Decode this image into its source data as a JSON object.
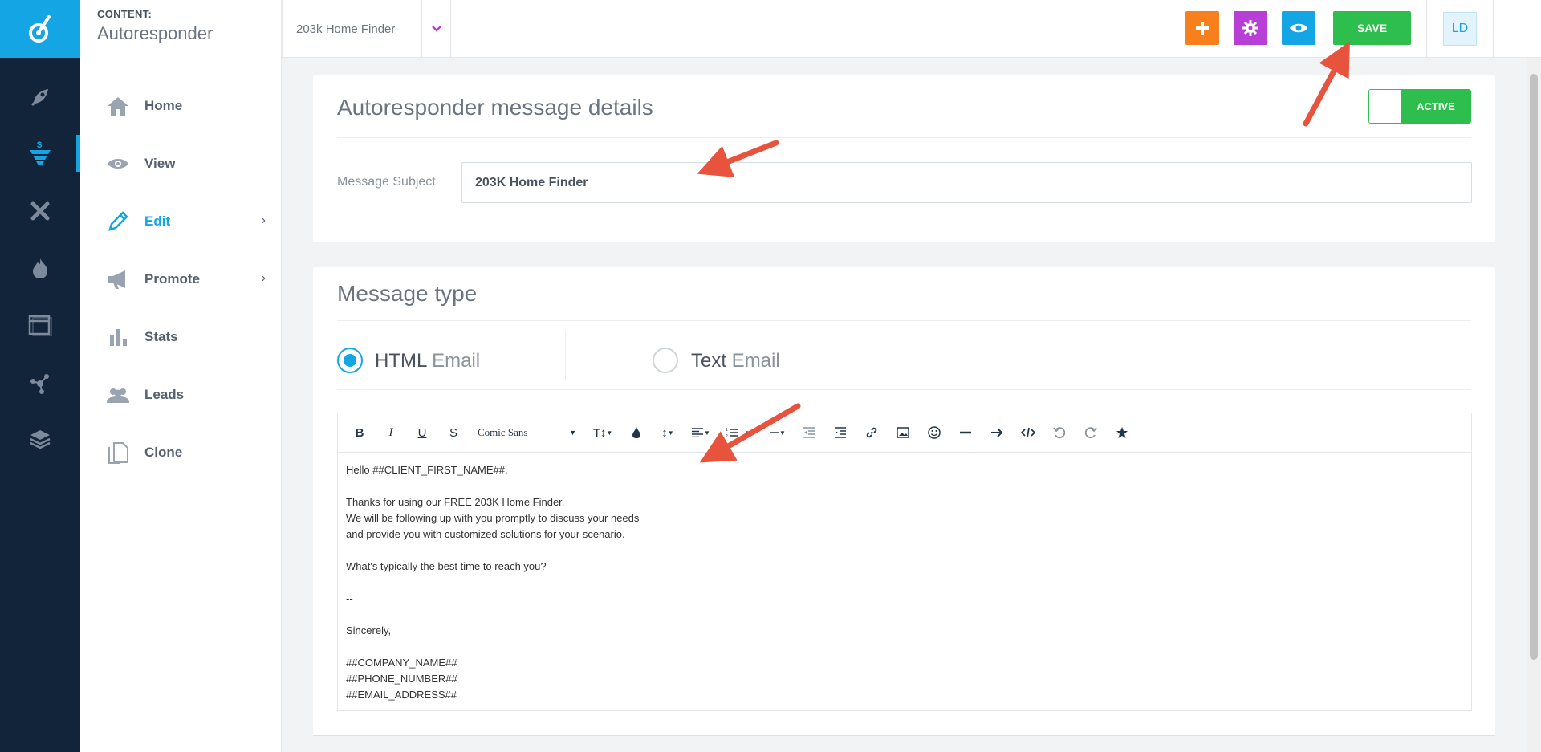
{
  "header": {
    "section_label": "CONTENT:",
    "section_title": "Autoresponder",
    "crumb": "203k Home Finder",
    "save_label": "SAVE",
    "avatar_initials": "LD"
  },
  "sidebar": {
    "items": [
      {
        "label": "Home",
        "icon": "home-icon"
      },
      {
        "label": "View",
        "icon": "eye-icon"
      },
      {
        "label": "Edit",
        "icon": "pencil-icon",
        "active": true
      },
      {
        "label": "Promote",
        "icon": "megaphone-icon"
      },
      {
        "label": "Stats",
        "icon": "bar-chart-icon"
      },
      {
        "label": "Leads",
        "icon": "people-icon"
      },
      {
        "label": "Clone",
        "icon": "copy-icon"
      }
    ]
  },
  "details": {
    "title": "Autoresponder message details",
    "toggle_label": "ACTIVE",
    "subject_label": "Message Subject",
    "subject_value": "203K Home Finder"
  },
  "message_type": {
    "title": "Message type",
    "html_main": "HTML",
    "html_sub": " Email",
    "text_main": "Text",
    "text_sub": " Email",
    "selected": "html"
  },
  "editor": {
    "font_name": "Comic Sans",
    "body_lines": [
      " Hello ##CLIENT_FIRST_NAME##,",
      "",
      "Thanks for using our FREE 203K Home Finder.",
      "We will be following up with you promptly to discuss your needs",
      "and provide you with customized solutions for your scenario.",
      "",
      "What's typically the best time to reach you?",
      "",
      "--",
      "",
      "Sincerely,",
      "",
      "##COMPANY_NAME##",
      "##PHONE_NUMBER##",
      "##EMAIL_ADDRESS##"
    ]
  },
  "colors": {
    "accent": "#14a5e4",
    "rail": "#12243a",
    "save": "#2dbe4e",
    "add": "#f7801d",
    "settings": "#b83fd6",
    "preview": "#14a5e4",
    "annotation_arrow": "#e8533e"
  }
}
